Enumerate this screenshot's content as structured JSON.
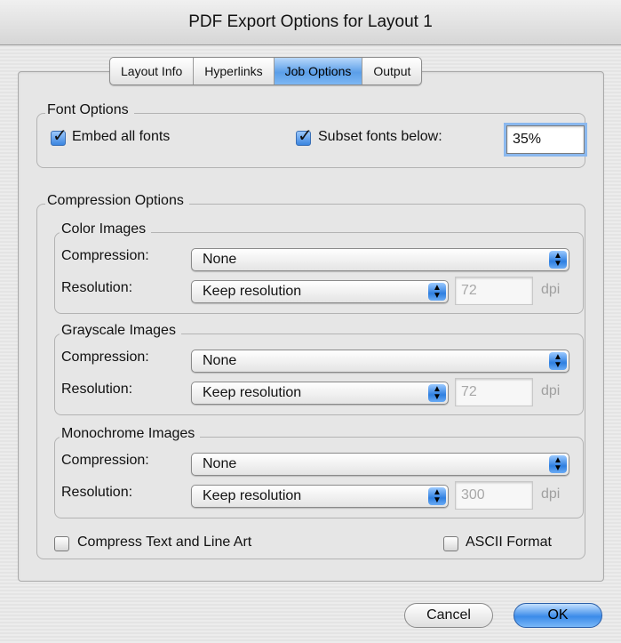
{
  "window": {
    "title": "PDF Export Options for Layout 1"
  },
  "tabs": [
    {
      "label": "Layout Info",
      "active": false
    },
    {
      "label": "Hyperlinks",
      "active": false
    },
    {
      "label": "Job Options",
      "active": true
    },
    {
      "label": "Output",
      "active": false
    }
  ],
  "font_options": {
    "title": "Font Options",
    "embed_all_fonts": {
      "label": "Embed all fonts",
      "checked": true
    },
    "subset_fonts": {
      "label": "Subset fonts below:",
      "checked": true,
      "value": "35%"
    }
  },
  "compression_options": {
    "title": "Compression Options",
    "compression_label": "Compression:",
    "resolution_label": "Resolution:",
    "dpi_unit": "dpi",
    "color_images": {
      "title": "Color Images",
      "compression": "None",
      "resolution": "Keep resolution",
      "dpi": "72"
    },
    "grayscale_images": {
      "title": "Grayscale Images",
      "compression": "None",
      "resolution": "Keep resolution",
      "dpi": "72"
    },
    "monochrome_images": {
      "title": "Monochrome Images",
      "compression": "None",
      "resolution": "Keep resolution",
      "dpi": "300"
    }
  },
  "compress_text": {
    "label": "Compress Text and Line Art",
    "checked": false
  },
  "ascii_format": {
    "label": "ASCII Format",
    "checked": false
  },
  "buttons": {
    "cancel": "Cancel",
    "ok": "OK"
  },
  "colors": {
    "accent": "#3b8be9",
    "tab_active": "#5b9ee8"
  },
  "icons": {
    "checkmark": "checkmark-icon",
    "popup": "popup-arrows-icon"
  }
}
